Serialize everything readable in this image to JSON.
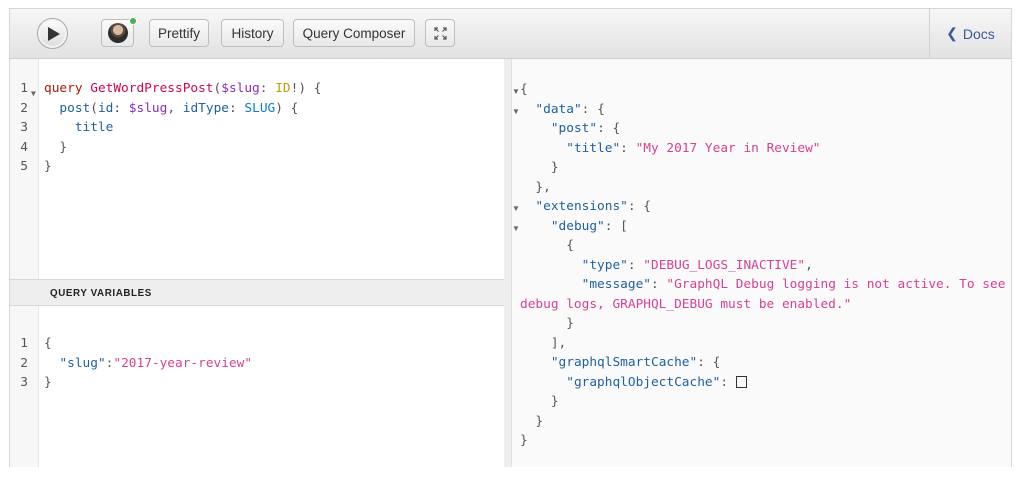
{
  "toolbar": {
    "run_icon": "play-icon",
    "prettify": "Prettify",
    "history": "History",
    "composer": "Query Composer",
    "expand_icon": "expand-icon",
    "docs": "Docs",
    "docs_icon": "chevron-left-icon"
  },
  "query_editor": {
    "line_numbers": [
      "1",
      "2",
      "3",
      "4",
      "5"
    ],
    "lines": [
      {
        "t1": "query",
        "t2": " GetWordPressPost",
        "t3": "(",
        "t4": "$slug",
        "t5": ": ",
        "t6": "ID",
        "t7": "!) {"
      },
      {
        "t1": "  post",
        "t2": "(",
        "t3": "id",
        "t4": ": ",
        "t5": "$slug",
        "t6": ", ",
        "t7": "idType",
        "t8": ": ",
        "t9": "SLUG",
        "t10": ") {"
      },
      {
        "t1": "    title"
      },
      {
        "t1": "  }"
      },
      {
        "t1": "}"
      }
    ]
  },
  "variables": {
    "header": "QUERY VARIABLES",
    "line_numbers": [
      "1",
      "2",
      "3"
    ],
    "open": "{",
    "key": "\"slug\"",
    "colon": ":",
    "value": "\"2017-year-review\"",
    "close": "}"
  },
  "result": {
    "lines": [
      {
        "indent": "",
        "k": "",
        "p": "{"
      },
      {
        "indent": "  ",
        "k": "\"data\"",
        "p": ": {"
      },
      {
        "indent": "    ",
        "k": "\"post\"",
        "p": ": {"
      },
      {
        "indent": "      ",
        "k": "\"title\"",
        "p": ": ",
        "s": "\"My 2017 Year in Review\""
      },
      {
        "indent": "    ",
        "k": "",
        "p": "}"
      },
      {
        "indent": "  ",
        "k": "",
        "p": "},"
      },
      {
        "indent": "  ",
        "k": "\"extensions\"",
        "p": ": {"
      },
      {
        "indent": "    ",
        "k": "\"debug\"",
        "p": ": ["
      },
      {
        "indent": "      ",
        "k": "",
        "p": "{"
      },
      {
        "indent": "        ",
        "k": "\"type\"",
        "p": ": ",
        "s": "\"DEBUG_LOGS_INACTIVE\"",
        "e": ","
      },
      {
        "indent": "        ",
        "k": "\"message\"",
        "p": ": ",
        "s": "\"GraphQL Debug logging is not active. To see"
      },
      {
        "indent": "",
        "k": "",
        "p": "",
        "s": "debug logs, GRAPHQL_DEBUG must be enabled.\""
      },
      {
        "indent": "      ",
        "k": "",
        "p": "}"
      },
      {
        "indent": "    ",
        "k": "",
        "p": "],"
      },
      {
        "indent": "    ",
        "k": "\"graphqlSmartCache\"",
        "p": ": {"
      },
      {
        "indent": "      ",
        "k": "\"graphqlObjectCache\"",
        "p": ": "
      },
      {
        "indent": "    ",
        "k": "",
        "p": "}"
      },
      {
        "indent": "  ",
        "k": "",
        "p": "}"
      },
      {
        "indent": "",
        "k": "",
        "p": "}"
      }
    ]
  }
}
